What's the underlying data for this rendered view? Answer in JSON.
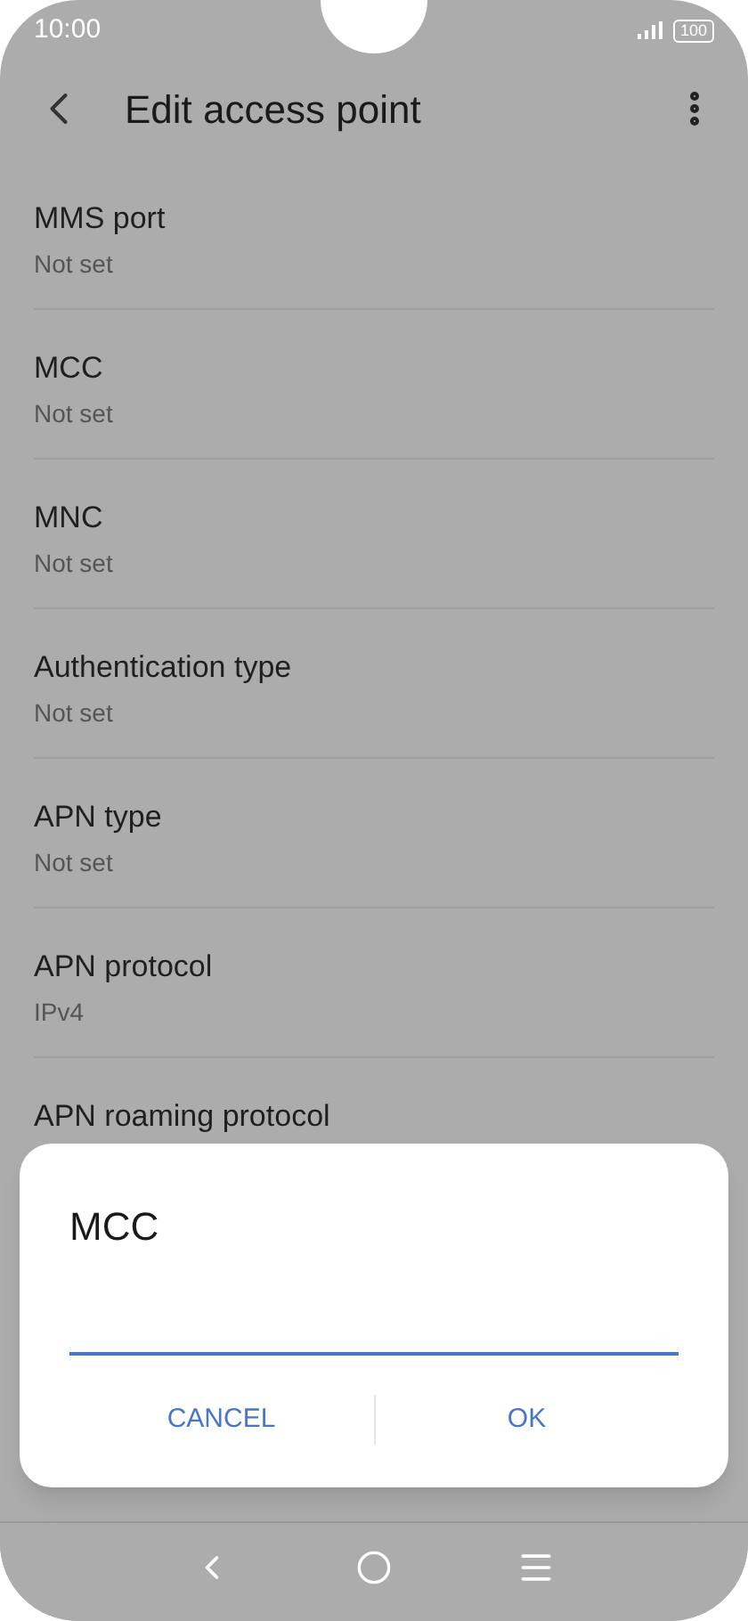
{
  "status_bar": {
    "time": "10:00",
    "battery": "100"
  },
  "app_bar": {
    "title": "Edit access point"
  },
  "settings": [
    {
      "title": "MMS port",
      "value": "Not set"
    },
    {
      "title": "MCC",
      "value": "Not set"
    },
    {
      "title": "MNC",
      "value": "Not set"
    },
    {
      "title": "Authentication type",
      "value": "Not set"
    },
    {
      "title": "APN type",
      "value": "Not set"
    },
    {
      "title": "APN protocol",
      "value": "IPv4"
    },
    {
      "title": "APN roaming protocol"
    }
  ],
  "dialog": {
    "title": "MCC",
    "buttons": [
      "CANCEL",
      "OK"
    ]
  }
}
